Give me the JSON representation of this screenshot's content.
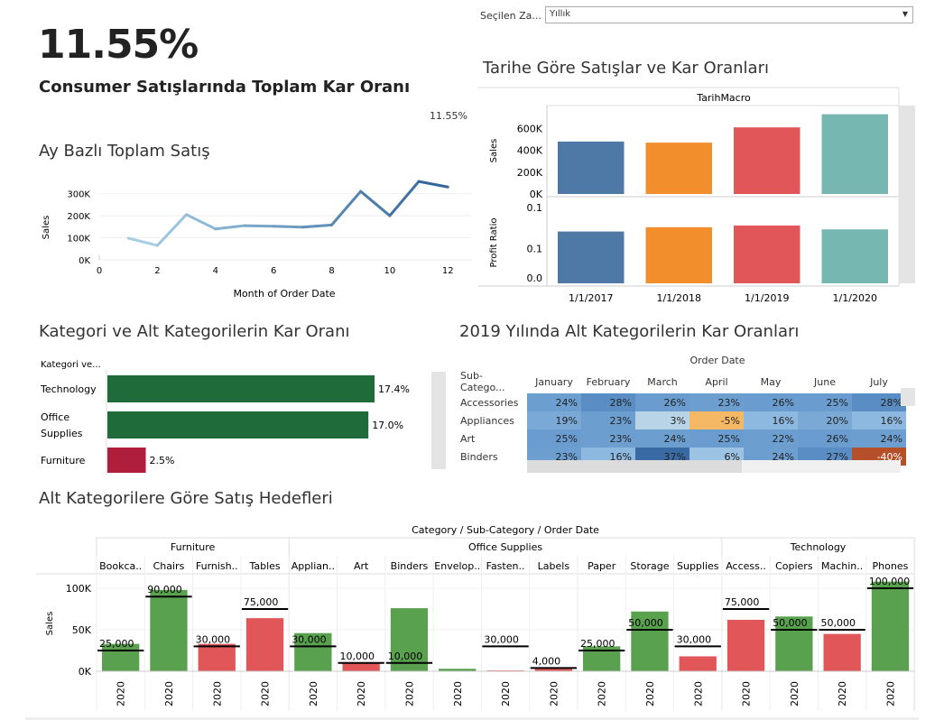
{
  "kpi": {
    "value": "11.55%",
    "subtitle": "Consumer  Satışlarında Toplam Kar Oranı",
    "small": "11.55%"
  },
  "filter": {
    "label": "Seçilen Za...",
    "value": "Yıllık"
  },
  "line_chart": {
    "title": "Ay Bazlı Toplam Satış",
    "ylabel": "Sales",
    "xlabel": "Month of Order Date",
    "chart_data": {
      "type": "line",
      "x": [
        1,
        2,
        3,
        4,
        5,
        6,
        7,
        8,
        9,
        10,
        11,
        12
      ],
      "values": [
        98000,
        65000,
        205000,
        140000,
        155000,
        152000,
        148000,
        158000,
        310000,
        200000,
        355000,
        330000
      ],
      "yticks": [
        "300K",
        "200K",
        "100K",
        "0K"
      ],
      "xticks": [
        "0",
        "2",
        "4",
        "6",
        "8",
        "10",
        "12"
      ],
      "ylim": [
        0,
        380000
      ],
      "xlim": [
        0,
        12.8
      ]
    }
  },
  "year_chart": {
    "title": "Tarihe Göre Satışlar ve Kar Oranları",
    "header": "TarihMacro",
    "ylabel_top": "Sales",
    "ylabel_bottom": "Profit Ratio",
    "chart_data": {
      "type": "bar",
      "categories": [
        "1/1/2017",
        "1/1/2018",
        "1/1/2019",
        "1/1/2020"
      ],
      "series": [
        {
          "name": "Sales",
          "values": [
            480000,
            470000,
            610000,
            730000
          ]
        },
        {
          "name": "Profit Ratio",
          "values": [
            0.121,
            0.131,
            0.135,
            0.126
          ]
        }
      ],
      "colors": [
        "#4e79a7",
        "#f28e2b",
        "#e15759",
        "#76b7b2"
      ],
      "yticks_top": [
        "600K",
        "400K",
        "200K",
        "0K"
      ],
      "yticks_bottom": [
        "0.1",
        "0.1",
        "0.0"
      ]
    }
  },
  "cat_chart": {
    "title": "Kategori ve Alt Kategorilerin Kar Oranı",
    "header": "Kategori ve...",
    "chart_data": {
      "type": "bar",
      "categories": [
        "Technology",
        "Office Supplies",
        "Furniture"
      ],
      "values": [
        17.4,
        17.0,
        2.5
      ],
      "labels": [
        "17.4%",
        "17.0%",
        "2.5%"
      ],
      "colors": [
        "#1f6b3a",
        "#1f6b3a",
        "#b01e3e"
      ]
    }
  },
  "heatmap": {
    "title": "2019 Yılında Alt Kategorilerin Kar Oranları",
    "header": "Order Date",
    "rowhead": "Sub-Catego...",
    "months": [
      "January",
      "February",
      "March",
      "April",
      "May",
      "June",
      "July"
    ],
    "rows": [
      {
        "name": "Accessories",
        "values": [
          "24%",
          "28%",
          "26%",
          "23%",
          "26%",
          "25%",
          "28%"
        ]
      },
      {
        "name": "Appliances",
        "values": [
          "19%",
          "23%",
          "3%",
          "-5%",
          "16%",
          "20%",
          "16%"
        ]
      },
      {
        "name": "Art",
        "values": [
          "25%",
          "23%",
          "24%",
          "25%",
          "22%",
          "26%",
          "24%"
        ]
      },
      {
        "name": "Binders",
        "values": [
          "23%",
          "16%",
          "37%",
          "6%",
          "24%",
          "27%",
          "-40%"
        ]
      }
    ]
  },
  "target_chart": {
    "title": "Alt Kategorilere Göre Satış Hedefleri",
    "header": "Category / Sub-Category / Order Date",
    "ylabel": "Sales",
    "yticks": [
      "100K",
      "50K",
      "0K"
    ],
    "groups": [
      {
        "name": "Furniture",
        "span": 4
      },
      {
        "name": "Office Supplies",
        "span": 9
      },
      {
        "name": "Technology",
        "span": 4
      }
    ],
    "chart_data": {
      "type": "bar",
      "ylim": [
        0,
        120000
      ],
      "categories": [
        "Bookca..",
        "Chairs",
        "Furnish..",
        "Tables",
        "Applian..",
        "Art",
        "Binders",
        "Envelop..",
        "Fasten..",
        "Labels",
        "Paper",
        "Storage",
        "Supplies",
        "Access..",
        "Copiers",
        "Machin..",
        "Phones"
      ],
      "year": "2020",
      "values": [
        33000,
        98000,
        33000,
        64000,
        46000,
        10000,
        76000,
        3000,
        1000,
        3000,
        30000,
        72000,
        18000,
        62000,
        66000,
        45000,
        108000
      ],
      "targets": [
        25000,
        90000,
        30000,
        75000,
        30000,
        10000,
        10000,
        null,
        30000,
        4000,
        25000,
        50000,
        30000,
        75000,
        50000,
        50000,
        100000
      ],
      "target_labels": [
        "25,000",
        "90,000",
        "30,000",
        "75,000",
        "30,000",
        "10,000",
        "10,000",
        "",
        "30,000",
        "4,000",
        "25,000",
        "50,000",
        "30,000",
        "75,000",
        "50,000",
        "50,000",
        "100,000"
      ],
      "colors": [
        "g",
        "g",
        "r",
        "r",
        "g",
        "r",
        "g",
        "g",
        "r",
        "r",
        "g",
        "g",
        "r",
        "r",
        "g",
        "r",
        "g"
      ]
    }
  }
}
